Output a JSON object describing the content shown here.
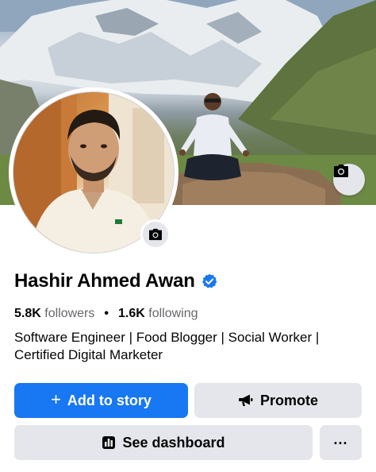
{
  "profile": {
    "name": "Hashir Ahmed Awan",
    "verified": true,
    "followers_count": "5.8K",
    "followers_label": "followers",
    "following_count": "1.6K",
    "following_label": "following",
    "separator": "•",
    "bio": "Software Engineer | Food Blogger | Social Worker | Certified Digital Marketer"
  },
  "actions": {
    "add_to_story_icon": "+",
    "add_to_story": "Add to story",
    "promote": "Promote",
    "see_dashboard": "See dashboard",
    "more": "..."
  },
  "icons": {
    "cover_camera": "camera-icon",
    "avatar_camera": "camera-icon",
    "verified": "verified-badge-icon",
    "promote": "megaphone-icon",
    "dashboard": "bar-chart-icon",
    "more": "more-horizontal-icon"
  },
  "colors": {
    "primary": "#1877f2",
    "secondary_button": "#e4e6eb",
    "verified_badge": "#1877f2",
    "muted_text": "#65676b"
  }
}
